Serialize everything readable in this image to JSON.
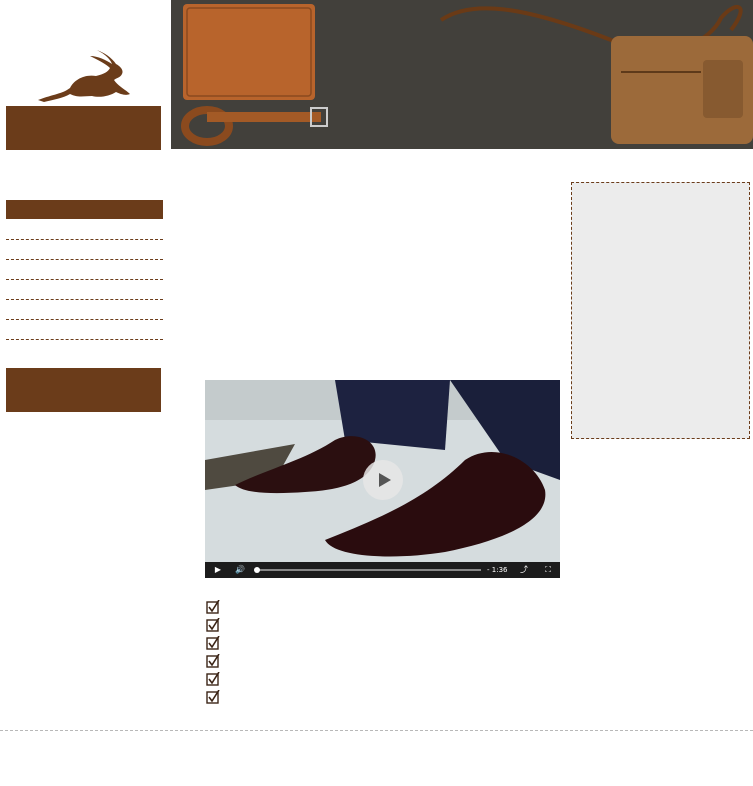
{
  "brand": {
    "logo_icon": "rabbit-logo-icon",
    "color": "#6b3c1a"
  },
  "sidebar": {
    "items": [
      {
        "label": "",
        "active": true
      },
      {
        "label": ""
      },
      {
        "label": ""
      },
      {
        "label": ""
      },
      {
        "label": ""
      },
      {
        "label": ""
      },
      {
        "label": ""
      }
    ]
  },
  "banner": {
    "image": "leather-goods-banner",
    "subjects": [
      "leather-portfolio",
      "leather-belt",
      "leather-crossbody-bag"
    ]
  },
  "video": {
    "image": "dress-shoes-video-frame",
    "remaining_time": "- 1:36",
    "progress": 0.0,
    "controls": [
      "play-icon",
      "volume-icon",
      "share-icon",
      "fullscreen-icon"
    ]
  },
  "checklist": {
    "icon": "checkbox-checked-icon",
    "count": 6,
    "items": [
      "",
      "",
      "",
      "",
      "",
      ""
    ]
  },
  "aside": {
    "background": "#ececec"
  }
}
